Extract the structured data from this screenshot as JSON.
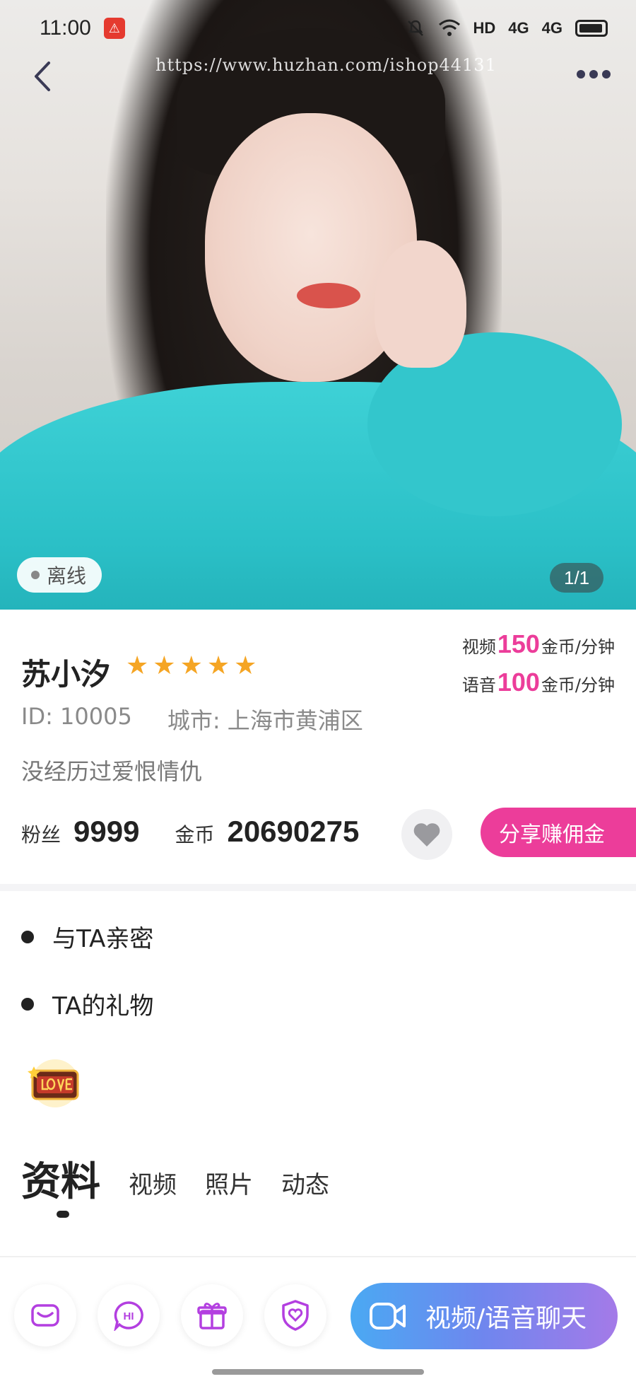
{
  "status_bar": {
    "time": "11:00",
    "signal_labels": [
      "HD",
      "4G",
      "4G"
    ]
  },
  "watermark": "https://www.huzhan.com/ishop44131",
  "photo": {
    "online_status": "离线",
    "counter": "1/1"
  },
  "profile": {
    "name": "苏小汐",
    "stars": [
      "★",
      "★",
      "★",
      "★",
      "★"
    ],
    "rating": 5,
    "id_text": "ID: 10005",
    "city_text": "城市: 上海市黄浦区",
    "bio": "没经历过爱恨情仇",
    "fans_label": "粉丝",
    "fans_value": "9999",
    "coins_label": "金币",
    "coins_value": "20690275",
    "share_label": "分享赚佣金",
    "video_price": {
      "prefix": "视频",
      "value": "150",
      "unit": "金币/分钟"
    },
    "voice_price": {
      "prefix": "语音",
      "value": "100",
      "unit": "金币/分钟"
    }
  },
  "sections": {
    "intimate": "与TA亲密",
    "gifts": "TA的礼物"
  },
  "tabs": [
    {
      "label": "资料",
      "active": true
    },
    {
      "label": "视频",
      "active": false
    },
    {
      "label": "照片",
      "active": false
    },
    {
      "label": "动态",
      "active": false
    }
  ],
  "bottom_bar": {
    "icons": [
      "message-icon",
      "hi-icon",
      "gift-icon",
      "heart-shield-icon"
    ],
    "hi_text": "HI",
    "chat_label": "视频/语音聊天"
  },
  "colors": {
    "accent_pink": "#ec3d9a",
    "star": "#f5a524",
    "icon_purple": "#b33fe0",
    "gradient_start": "#4aa9f3",
    "gradient_end": "#a47ae8"
  }
}
